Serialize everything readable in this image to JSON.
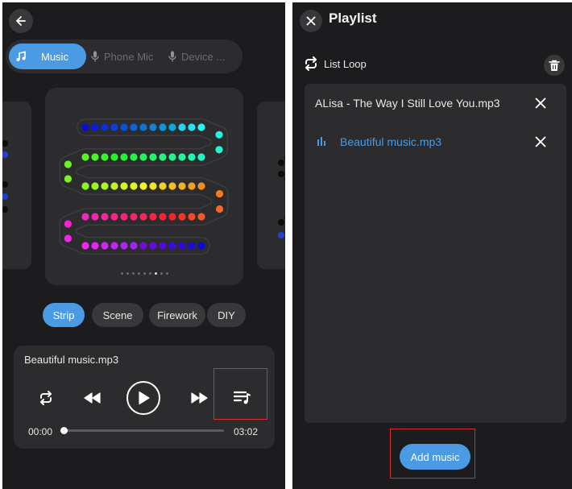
{
  "source_tabs": [
    {
      "label": "Music",
      "icon": "music-note-icon",
      "active": true
    },
    {
      "label": "Phone Mic",
      "icon": "microphone-icon",
      "active": false
    },
    {
      "label": "Device ...",
      "icon": "microphone-icon",
      "active": false
    }
  ],
  "carousel": {
    "pages": 9,
    "current_page_index": 6
  },
  "mode_tabs": [
    {
      "label": "Strip",
      "active": true
    },
    {
      "label": "Scene",
      "active": false
    },
    {
      "label": "Firework",
      "active": false
    },
    {
      "label": "DIY",
      "active": false
    }
  ],
  "player": {
    "track_title": "Beautiful music.mp3",
    "time_current": "00:00",
    "time_total": "03:02",
    "progress_fraction": 0.0
  },
  "playlist": {
    "title": "Playlist",
    "loop_mode_label": "List Loop",
    "items": [
      {
        "name": "ALisa - The Way I Still Love You.mp3",
        "current": false
      },
      {
        "name": "Beautiful music.mp3",
        "current": true
      }
    ],
    "add_button_label": "Add music"
  },
  "colors": {
    "accent": "#4a9be3",
    "background": "#1c1c1e",
    "card": "#2c2c2e",
    "highlight_outline": "#d32f2f"
  }
}
